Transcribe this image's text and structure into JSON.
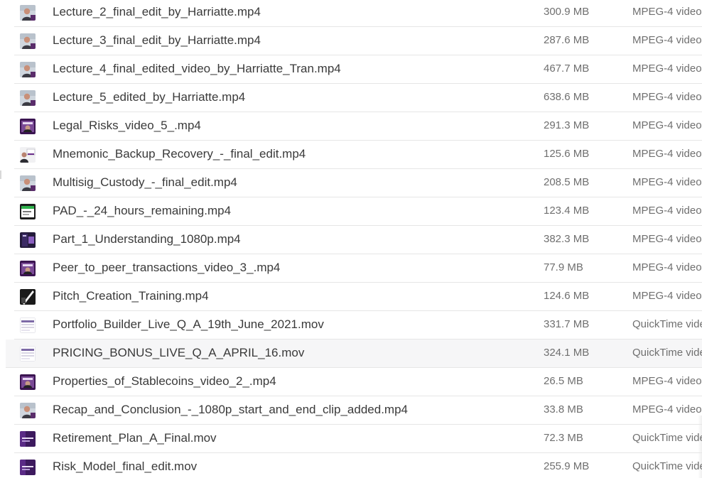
{
  "files": [
    {
      "name": "Lecture_2_final_edit_by_Harriatte.mp4",
      "size": "300.9 MB",
      "kind": "MPEG-4 video",
      "thumb": "person-video-thumb-icon"
    },
    {
      "name": "Lecture_3_final_edit_by_Harriatte.mp4",
      "size": "287.6 MB",
      "kind": "MPEG-4 video",
      "thumb": "person-video-thumb-icon"
    },
    {
      "name": "Lecture_4_final_edited_video_by_Harriatte_Tran.mp4",
      "size": "467.7 MB",
      "kind": "MPEG-4 video",
      "thumb": "person-video-thumb-icon"
    },
    {
      "name": "Lecture_5_edited_by_Harriatte.mp4",
      "size": "638.6 MB",
      "kind": "MPEG-4 video",
      "thumb": "person-video-thumb-icon"
    },
    {
      "name": "Legal_Risks_video_5_.mp4",
      "size": "291.3 MB",
      "kind": "MPEG-4 video",
      "thumb": "purple-frame-video-thumb-icon"
    },
    {
      "name": "Mnemonic_Backup_Recovery_-_final_edit.mp4",
      "size": "125.6 MB",
      "kind": "MPEG-4 video",
      "thumb": "presentation-video-thumb-icon"
    },
    {
      "name": "Multisig_Custody_-_final_edit.mp4",
      "size": "208.5 MB",
      "kind": "MPEG-4 video",
      "thumb": "person-video-thumb-icon"
    },
    {
      "name": "PAD_-_24_hours_remaining.mp4",
      "size": "123.4 MB",
      "kind": "MPEG-4 video",
      "thumb": "green-slide-video-thumb-icon"
    },
    {
      "name": "Part_1_Understanding_1080p.mp4",
      "size": "382.3 MB",
      "kind": "MPEG-4 video",
      "thumb": "dark-purple-video-thumb-icon"
    },
    {
      "name": "Peer_to_peer_transactions_video_3_.mp4",
      "size": "77.9 MB",
      "kind": "MPEG-4 video",
      "thumb": "purple-frame-video-thumb-icon"
    },
    {
      "name": "Pitch_Creation_Training.mp4",
      "size": "124.6 MB",
      "kind": "MPEG-4 video",
      "thumb": "black-slide-video-thumb-icon"
    },
    {
      "name": "Portfolio_Builder_Live_Q_A_19th_June_2021.mov",
      "size": "331.7 MB",
      "kind": "QuickTime video",
      "thumb": "screen-video-thumb-icon"
    },
    {
      "name": "PRICING_BONUS_LIVE_Q_A_APRIL_16.mov",
      "size": "324.1 MB",
      "kind": "QuickTime video",
      "thumb": "screen-video-thumb-icon"
    },
    {
      "name": "Properties_of_Stablecoins_video_2_.mp4",
      "size": "26.5 MB",
      "kind": "MPEG-4 video",
      "thumb": "purple-frame-video-thumb-icon"
    },
    {
      "name": "Recap_and_Conclusion_-_1080p_start_and_end_clip_added.mp4",
      "size": "33.8 MB",
      "kind": "MPEG-4 video",
      "thumb": "person-video-thumb-icon"
    },
    {
      "name": "Retirement_Plan_A_Final.mov",
      "size": "72.3 MB",
      "kind": "QuickTime video",
      "thumb": "purple-title-video-thumb-icon"
    },
    {
      "name": "Risk_Model_final_edit.mov",
      "size": "255.9 MB",
      "kind": "QuickTime video",
      "thumb": "purple-title-video-thumb-icon"
    }
  ],
  "hovered_row_index": 12
}
